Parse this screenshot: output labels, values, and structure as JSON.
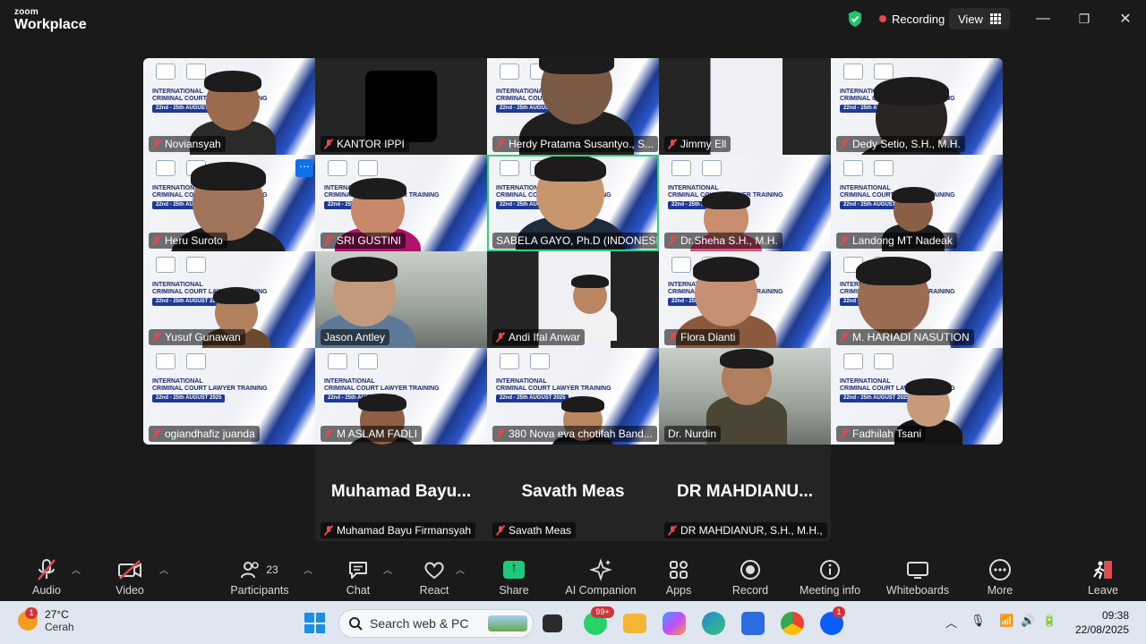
{
  "app": {
    "brand_line1": "zoom",
    "brand_line2": "Workplace"
  },
  "header": {
    "recording_label": "Recording",
    "view_label": "View"
  },
  "gallery": {
    "banner": {
      "line1": "INTERNATIONAL",
      "line2": "CRIMINAL COURT LAWYER TRAINING",
      "dates": "22nd - 25th AUGUST 2025"
    },
    "tiles": [
      {
        "name": "Noviansyah",
        "muted": true
      },
      {
        "name": "KANTOR IPPI",
        "muted": true
      },
      {
        "name": "Herdy Pratama Susantyo., S...",
        "muted": true
      },
      {
        "name": "Jimmy Ell",
        "muted": true
      },
      {
        "name": "Dedy Setio, S.H., M.H.",
        "muted": true
      },
      {
        "name": "Heru Suroto",
        "muted": true
      },
      {
        "name": "SRI GUSTINI",
        "muted": true
      },
      {
        "name": "SABELA GAYO, Ph.D (INDONESI...",
        "muted": false
      },
      {
        "name": "Dr.Sheha S.H., M.H.",
        "muted": true
      },
      {
        "name": "Landong MT Nadeak",
        "muted": true
      },
      {
        "name": "Yusuf Gunawan",
        "muted": true
      },
      {
        "name": "Jason Antley",
        "muted": false
      },
      {
        "name": "Andi Ifal Anwar",
        "muted": true
      },
      {
        "name": "Flora Dianti",
        "muted": true
      },
      {
        "name": "M. HARIADI NASUTION",
        "muted": true
      },
      {
        "name": "ogiandhafiz juanda",
        "muted": true
      },
      {
        "name": "M ASLAM FADLI",
        "muted": true
      },
      {
        "name": "380 Nova eva chotifah Band...",
        "muted": true
      },
      {
        "name": "Dr. Nurdin",
        "muted": false
      },
      {
        "name": "Fadhilah Tsani",
        "muted": true
      }
    ],
    "text_tiles": [
      {
        "big": "Muhamad Bayu...",
        "name": "Muhamad Bayu Firmansyah"
      },
      {
        "big": "Savath Meas",
        "name": "Savath Meas"
      },
      {
        "big": "DR MAHDIANU...",
        "name": "DR MAHDIANUR, S.H., M.H.,"
      }
    ]
  },
  "toolbar": {
    "audio": "Audio",
    "video": "Video",
    "participants": "Participants",
    "participants_count": "23",
    "chat": "Chat",
    "react": "React",
    "share": "Share",
    "ai_companion": "AI Companion",
    "apps": "Apps",
    "record": "Record",
    "meeting_info": "Meeting info",
    "whiteboards": "Whiteboards",
    "more": "More",
    "leave": "Leave"
  },
  "taskbar": {
    "weather_temp": "27°C",
    "weather_desc": "Cerah",
    "weather_badge": "1",
    "search_placeholder": "Search web & PC",
    "whatsapp_badge": "99+",
    "zoom_badge": "1",
    "time": "09:38",
    "date": "22/08/2025"
  },
  "colors": {
    "accent_green": "#2fd07b",
    "muted_red": "#e5484d",
    "share_green": "#1fc97a",
    "zoom_blue": "#0e71eb"
  }
}
